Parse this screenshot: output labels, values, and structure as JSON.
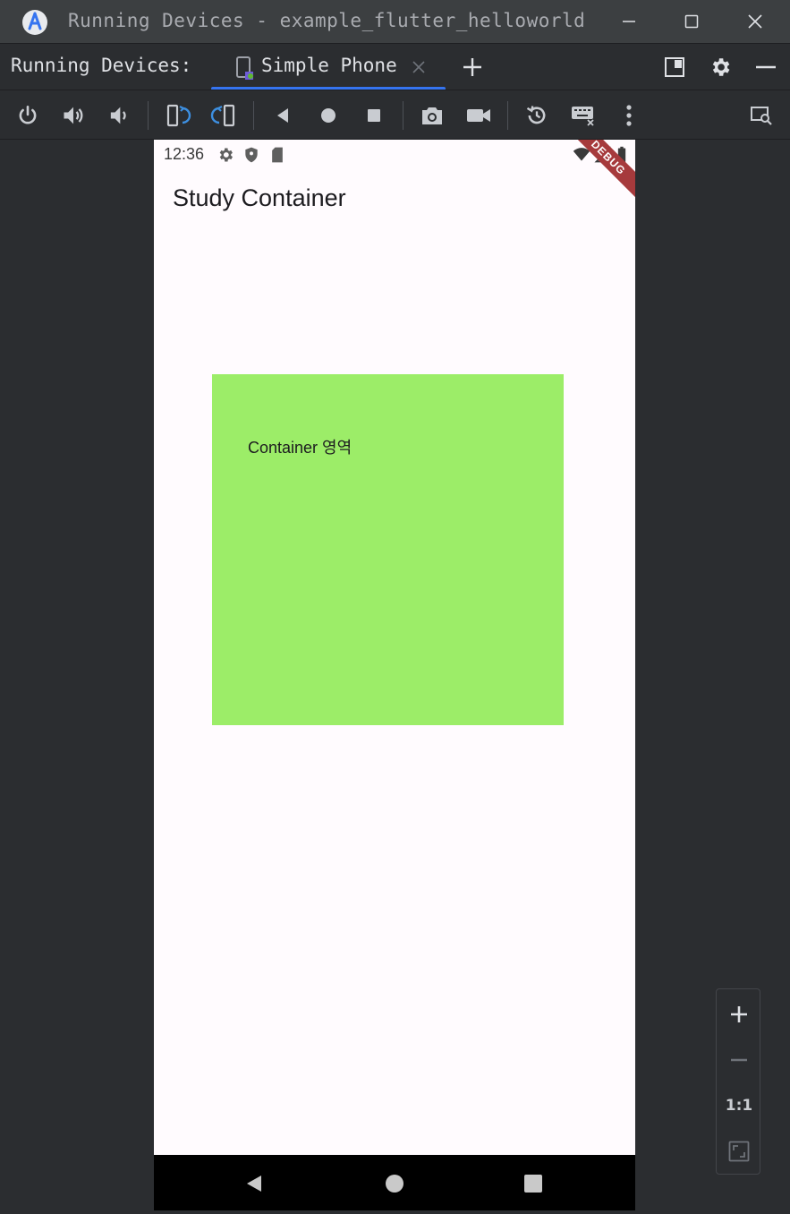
{
  "window": {
    "title": "Running Devices - example_flutter_helloworld"
  },
  "tabbar": {
    "label": "Running Devices:",
    "tabs": [
      {
        "label": "Simple Phone"
      }
    ]
  },
  "toolbar": {
    "icons": [
      "power-icon",
      "volume-up-icon",
      "volume-down-icon",
      "rotate-left-icon",
      "rotate-right-icon",
      "back-icon",
      "home-icon",
      "overview-icon",
      "screenshot-icon",
      "screen-record-icon",
      "reset-icon",
      "keyboard-icon",
      "more-icon",
      "device-explorer-icon"
    ]
  },
  "phone": {
    "status_bar": {
      "time": "12:36"
    },
    "debug_banner": "DEBUG",
    "app_title": "Study Container",
    "container_text": "Container 영역",
    "container_color": "#9ced68"
  },
  "zoom": {
    "actual_size_label": "1:1"
  },
  "colors": {
    "accent": "#3574f0",
    "background": "#2b2d30",
    "phone_background": "#fffbfe",
    "debug_banner": "#a63a3c"
  }
}
